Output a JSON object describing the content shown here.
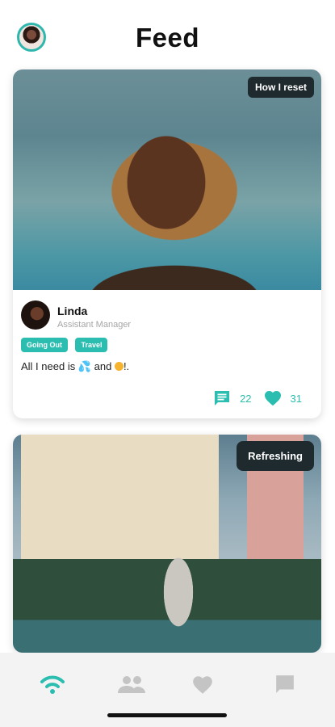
{
  "header": {
    "title": "Feed"
  },
  "posts": [
    {
      "photo_tag": "How I reset",
      "author": {
        "name": "Linda",
        "role": "Assistant Manager"
      },
      "tags": [
        "Going Out",
        "Travel"
      ],
      "caption": {
        "before": "All I need is ",
        "middle": " and ",
        "after": "!."
      },
      "comments": "22",
      "likes": "31"
    },
    {
      "photo_tag": "Refreshing"
    }
  ],
  "nav": {
    "items": [
      "feed-icon",
      "people-icon",
      "heart-icon",
      "chat-icon"
    ],
    "active_index": 0
  },
  "colors": {
    "accent": "#2abdb0",
    "nav_inactive": "#c4c4c4",
    "tag_bg": "#1f2a2e"
  }
}
